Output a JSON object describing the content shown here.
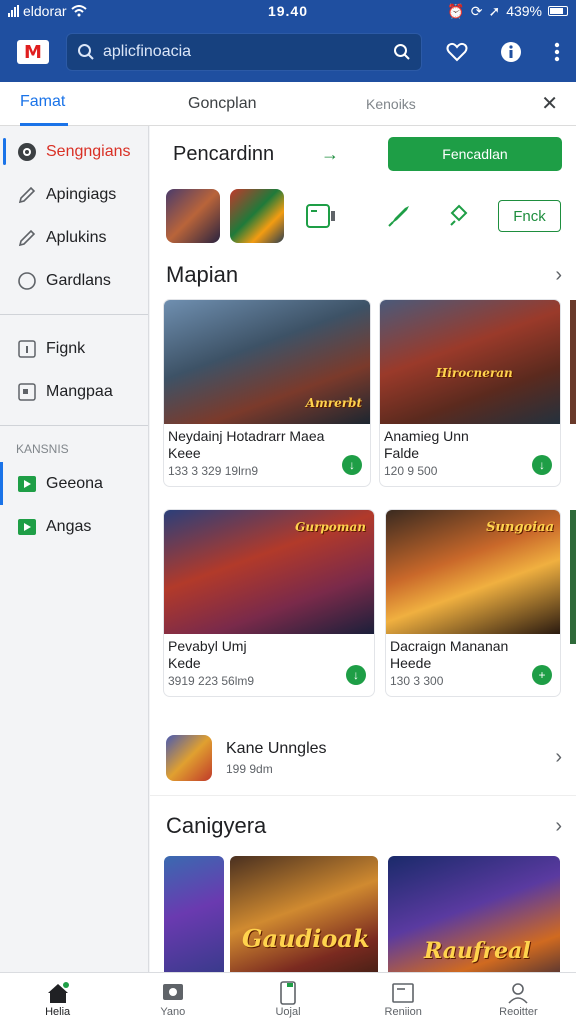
{
  "statusbar": {
    "carrier": "eldorar",
    "time": "19.40",
    "battery": "439%"
  },
  "topbar": {
    "logo_text": "M",
    "search_placeholder": "aplicfinoacia"
  },
  "tabs": [
    {
      "label": "Famat",
      "active": true
    },
    {
      "label": "Goncplan",
      "active": false
    },
    {
      "label": "Kenoiks",
      "active": false
    }
  ],
  "sidebar": {
    "items": [
      {
        "label": "Sengngians",
        "icon": "disc-icon",
        "active": true
      },
      {
        "label": "Apingiags",
        "icon": "pencil-icon"
      },
      {
        "label": "Aplukins",
        "icon": "pencil-icon"
      },
      {
        "label": "Gardlans",
        "icon": "circle-icon"
      }
    ],
    "items2": [
      {
        "label": "Fignk",
        "icon": "square-info-icon"
      },
      {
        "label": "Mangpaa",
        "icon": "image-icon"
      }
    ],
    "section_label": "KANSNIS",
    "items3": [
      {
        "label": "Geeona",
        "icon": "green-play-icon"
      },
      {
        "label": "Angas",
        "icon": "green-play-icon"
      }
    ]
  },
  "main": {
    "header": "Pencardinn",
    "header_button": "Fencadlan",
    "filter_button": "Fnck",
    "section1_title": "Mapian",
    "cards": [
      {
        "title": "Neydainj Hotadrarr Maea",
        "sub": "Keee",
        "meta": "133 3 329 19lrn9",
        "art_label": "Amrerbt"
      },
      {
        "title": "Anamieg Unn",
        "sub": "Falde",
        "meta": "120 9 500",
        "art_label": "Hirocneran"
      },
      {
        "title": "Pevabyl Umj",
        "sub": "Kede",
        "meta": "3919 223 56lm9",
        "art_label": "Gurpoman"
      },
      {
        "title": "Dacraign Mananan",
        "sub": "Heede",
        "meta": "130 3 300",
        "art_label": "Sungoiaa"
      }
    ],
    "list_item": {
      "title": "Kane Unngles",
      "meta": "199 9dm"
    },
    "section2_title": "Canigyera",
    "bottom_art": [
      "Gaudioak",
      "Raufreal"
    ]
  },
  "bottomnav": [
    {
      "label": "Helia",
      "icon": "home-icon",
      "active": true
    },
    {
      "label": "Yano",
      "icon": "tv-icon"
    },
    {
      "label": "Uojal",
      "icon": "phone-icon"
    },
    {
      "label": "Reniion",
      "icon": "board-icon"
    },
    {
      "label": "Reoitter",
      "icon": "person-icon"
    }
  ],
  "colors": {
    "brand": "#1f4fa0",
    "accent": "#1a73e8",
    "green": "#1e9e46",
    "active_red": "#d93025"
  }
}
